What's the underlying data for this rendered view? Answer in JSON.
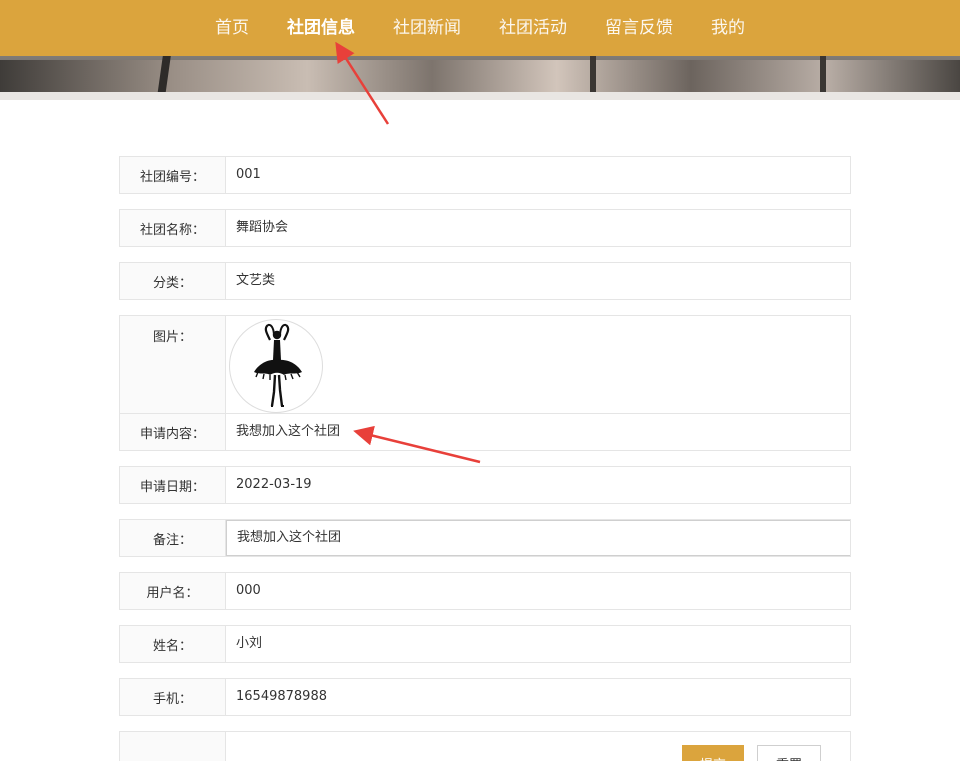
{
  "nav": {
    "items": [
      {
        "label": "首页",
        "active": false
      },
      {
        "label": "社团信息",
        "active": true
      },
      {
        "label": "社团新闻",
        "active": false
      },
      {
        "label": "社团活动",
        "active": false
      },
      {
        "label": "留言反馈",
        "active": false
      },
      {
        "label": "我的",
        "active": false
      }
    ],
    "bg_color": "#dba43d"
  },
  "form": {
    "club_id": {
      "label": "社团编号：",
      "value": "001"
    },
    "club_name": {
      "label": "社团名称：",
      "value": "舞蹈协会"
    },
    "category": {
      "label": "分类：",
      "value": "文艺类"
    },
    "picture": {
      "label": "图片：",
      "icon": "ballerina-silhouette"
    },
    "apply_content": {
      "label": "申请内容：",
      "value": "我想加入这个社团"
    },
    "apply_date": {
      "label": "申请日期：",
      "value": "2022-03-19"
    },
    "remark": {
      "label": "备注：",
      "value": "我想加入这个社团"
    },
    "username": {
      "label": "用户名：",
      "value": "000"
    },
    "real_name": {
      "label": "姓名：",
      "value": "小刘"
    },
    "phone": {
      "label": "手机：",
      "value": "16549878988"
    }
  },
  "buttons": {
    "submit_label": "提交",
    "reset_label": "重置"
  },
  "annotation_color": "#e8403a"
}
